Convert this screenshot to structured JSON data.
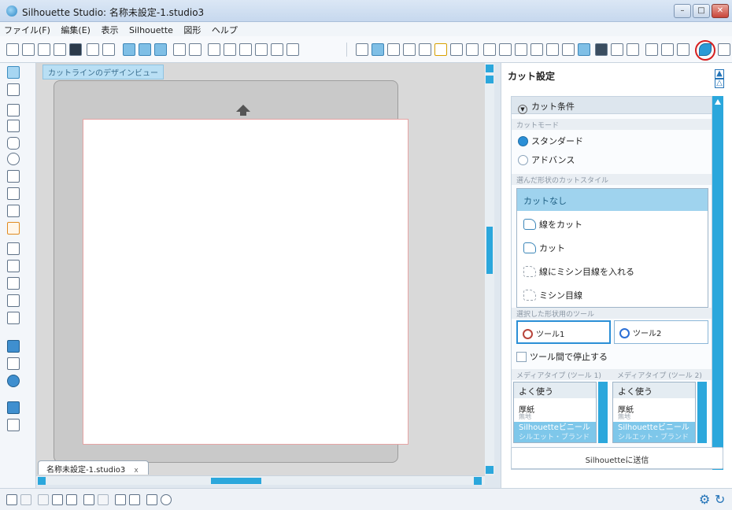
{
  "window": {
    "title": "Silhouette Studio: 名称未設定-1.studio3",
    "minimize": "–",
    "maximize": "□",
    "close": "✕"
  },
  "menu": [
    "ファイル(F)",
    "編集(E)",
    "表示",
    "Silhouette",
    "図形",
    "ヘルプ"
  ],
  "design": {
    "view_label": "カットラインのデザインビュー",
    "doc_tab": "名称未設定-1.studio3",
    "doc_tab_close": "x"
  },
  "panel": {
    "title": "カット設定",
    "section": "カット条件",
    "cut_mode_label": "カットモード",
    "mode_standard": "スタンダード",
    "mode_advanced": "アドバンス",
    "cut_style_label": "選んだ形状のカットスタイル",
    "cut_styles": [
      "カットなし",
      "線をカット",
      "カット",
      "線にミシン目線を入れる",
      "ミシン目線"
    ],
    "tool_label": "選択した形状用のツール",
    "tool1": "ツール1",
    "tool2": "ツール2",
    "stop_between_tools": "ツール間で停止する",
    "media1_label": "メディアタイプ (ツール 1)",
    "media2_label": "メディアタイプ (ツール 2)",
    "media_common": "よく使う",
    "media_item": "厚紙",
    "media_item_sub": "無地",
    "media_brand": "Silhouetteビニール",
    "media_brand_sub": "シルエット・ブランド",
    "send_button": "Silhouetteに送信"
  },
  "colors": {
    "accent": "#2ba7dc",
    "selected_item": "#9fd3ee",
    "tool1_ring": "#b8453c",
    "tool2_ring": "#2b6fd6",
    "highlight_circle": "#d62020"
  }
}
